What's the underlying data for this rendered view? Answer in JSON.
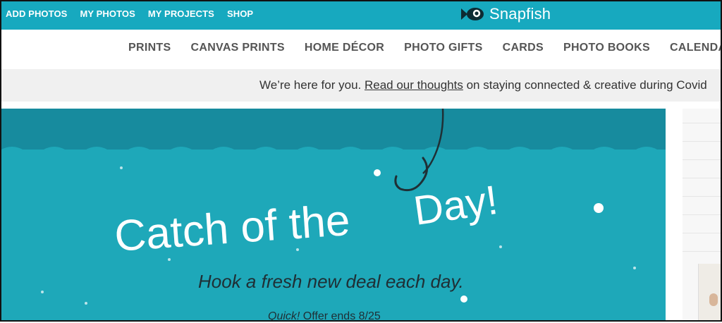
{
  "topbar": {
    "nav": [
      "ADD PHOTOS",
      "MY PHOTOS",
      "MY PROJECTS",
      "SHOP"
    ],
    "logo_text": "Snapfish",
    "logo_icon": "fish-icon",
    "background": "#17a9bf"
  },
  "category_nav": [
    "PRINTS",
    "CANVAS PRINTS",
    "HOME DÉCOR",
    "PHOTO GIFTS",
    "CARDS",
    "PHOTO BOOKS",
    "CALENDAR"
  ],
  "notice": {
    "before": "We’re here for you. ",
    "link": "Read our thoughts",
    "after": " on staying connected & creative during Covid"
  },
  "banner": {
    "headline_part1": "Catch of the",
    "headline_part2": "Day!",
    "subheadline": "Hook a fresh new deal each day.",
    "offer_prefix": "Quick!",
    "offer_text": " Offer ends 8/25",
    "colors": {
      "water": "#1ea8b9",
      "water_dark": "#178b9e",
      "hook": "#1f2f35"
    }
  }
}
